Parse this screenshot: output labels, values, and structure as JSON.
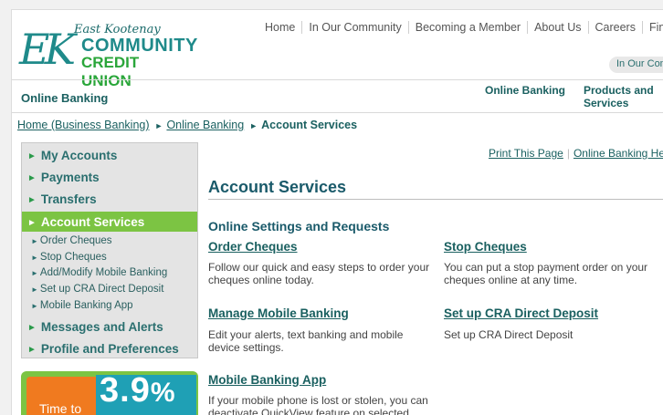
{
  "logo": {
    "mark": "EK",
    "region": "East Kootenay",
    "name_line1": "COMMUNITY",
    "name_line2": "CREDIT UNION"
  },
  "top_nav": [
    "Home",
    "In Our Community",
    "Becoming a Member",
    "About Us",
    "Careers",
    "Find Br"
  ],
  "top_pill": "In Our Com",
  "subbar": {
    "section_title": "Online Banking",
    "links": [
      "Online Banking",
      "Products and Services"
    ]
  },
  "breadcrumb": {
    "home": "Home (Business Banking)",
    "online_banking": "Online Banking",
    "current": "Account Services"
  },
  "sidebar": {
    "main_items": [
      "My Accounts",
      "Payments",
      "Transfers",
      "Account Services",
      "Messages and Alerts",
      "Profile and Preferences"
    ],
    "sub_items": [
      "Order Cheques",
      "Stop Cheques",
      "Add/Modify Mobile Banking",
      "Set up CRA Direct Deposit",
      "Mobile Banking App"
    ]
  },
  "promo": {
    "rate": "3.9",
    "percent": "%",
    "text": "Time to"
  },
  "utility_links": [
    "Print This Page",
    "Online Banking Help"
  ],
  "main": {
    "title": "Account Services",
    "group_title": "Online Settings and Requests",
    "services": [
      {
        "title": "Order Cheques",
        "desc": "Follow our quick and easy steps to order your cheques online today."
      },
      {
        "title": "Stop Cheques",
        "desc": "You can put a stop payment order on your cheques online at any time."
      },
      {
        "title": "Manage Mobile Banking",
        "desc": "Edit your alerts, text banking and mobile device settings."
      },
      {
        "title": "Set up CRA Direct Deposit",
        "desc": "Set up CRA Direct Deposit"
      },
      {
        "title": "Mobile Banking App",
        "desc": "If your mobile phone is lost or stolen, you can deactivate QuickView feature on selected"
      }
    ]
  },
  "colors": {
    "brand_teal": "#1f8a8a",
    "brand_green": "#7cc443",
    "link": "#1a6060",
    "promo_orange": "#f07a1f"
  }
}
